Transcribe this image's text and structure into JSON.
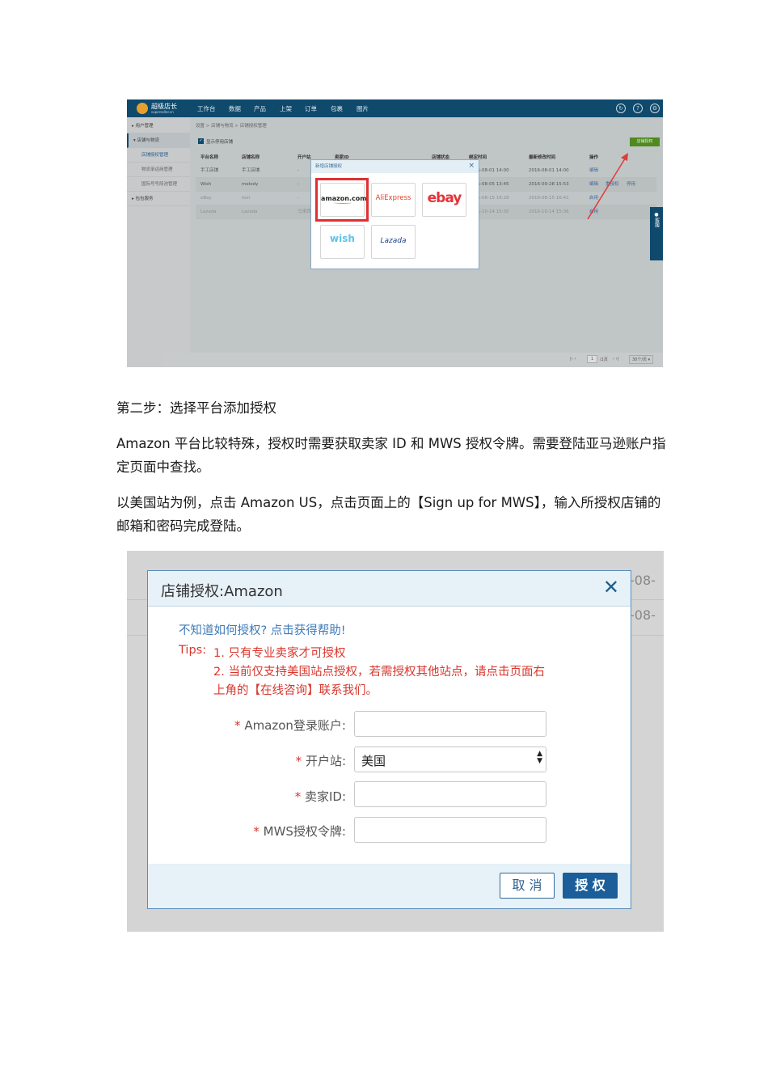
{
  "screenshot1": {
    "brand": "超级店长",
    "brand_sub": "superseller.cn",
    "nav": [
      "工作台",
      "数据",
      "产品",
      "上架",
      "订单",
      "包裹",
      "图片"
    ],
    "sidebar": [
      "用户管理",
      "店铺与物流",
      "店铺授权管理",
      "物流承运商管理",
      "国际号号段池管理",
      "包包服务"
    ],
    "breadcrumb": "设置 > 店铺与物流 > 店铺授权管理",
    "show_disabled": "显示停用店铺",
    "auth_button": "店铺授权",
    "columns": [
      "平台名称",
      "店铺名称",
      "开户站",
      "卖家ID",
      "店铺状态",
      "绑定时间",
      "最新修改时间",
      "操作"
    ],
    "rows": [
      {
        "platform": "手工店铺",
        "name": "手工店铺",
        "site": "-",
        "bind": "2016-08-01 14:00",
        "modified": "2016-08-01 14:00",
        "ops": [
          "编辑"
        ]
      },
      {
        "platform": "Wish",
        "name": "melody",
        "site": "-",
        "bind": "2016-08-05 13:45",
        "modified": "2016-09-28 15:53",
        "ops": [
          "编辑",
          "重授权",
          "停用"
        ]
      },
      {
        "platform": "eBay",
        "name": "test",
        "site": "-",
        "bind": "2016-08-15 16:28",
        "modified": "2016-08-15 16:41",
        "ops": [
          "启用"
        ]
      },
      {
        "platform": "Lazada",
        "name": "Lazada",
        "site": "马来西",
        "bind": "2016-10-14 15:30",
        "modified": "2016-10-14 15:36",
        "ops": [
          "启用"
        ]
      }
    ],
    "modal_title": "新增店铺授权",
    "platforms": [
      "amazon.com",
      "AliExpress",
      "ebay",
      "wish",
      "Lazada"
    ],
    "pager": {
      "page": "1",
      "total": "/1页",
      "per_page": "30个/页"
    },
    "kefu": "客服"
  },
  "text": {
    "step": "第二步：选择平台添加授权",
    "p1": "Amazon 平台比较特殊，授权时需要获取卖家 ID 和 MWS 授权令牌。需要登陆亚马逊账户指定页面中查找。",
    "p2": "以美国站为例，点击 Amazon US，点击页面上的【Sign up for MWS】，输入所授权店铺的邮箱和密码完成登陆。"
  },
  "screenshot2": {
    "ghost": [
      "-08-",
      "-08-"
    ],
    "title": "店铺授权:Amazon",
    "help": "不知道如何授权? 点击获得帮助!",
    "tips_label": "Tips:",
    "tip1": "1. 只有专业卖家才可授权",
    "tip2a": "2. 当前仅支持美国站点授权，若需授权其他站点，请点击页面右",
    "tip2b": "上角的【在线咨询】联系我们。",
    "fields": [
      {
        "label": "Amazon登录账户:",
        "value": ""
      },
      {
        "label": "开户站:",
        "value": "美国"
      },
      {
        "label": "卖家ID:",
        "value": ""
      },
      {
        "label": "MWS授权令牌:",
        "value": ""
      }
    ],
    "cancel": "取 消",
    "ok": "授 权"
  }
}
